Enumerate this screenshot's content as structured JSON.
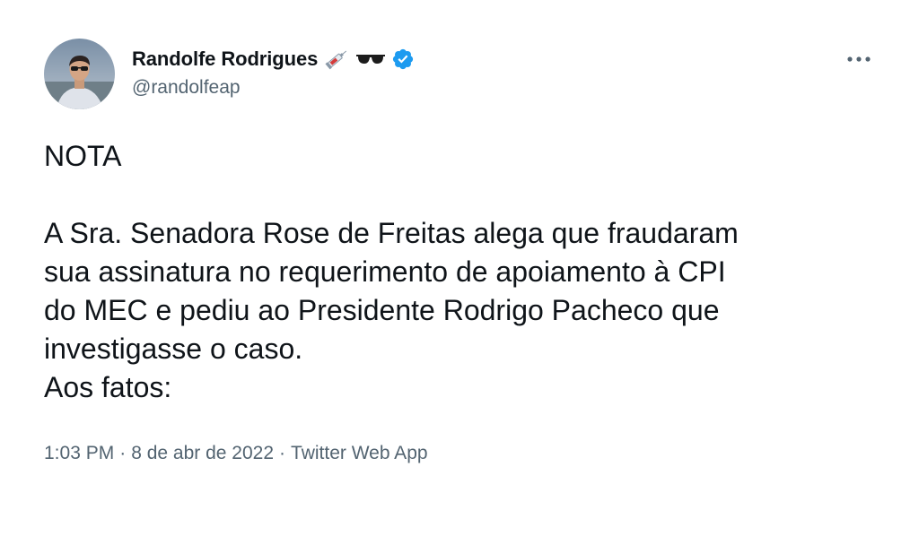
{
  "tweet": {
    "author": {
      "name": "Randolfe Rodrigues",
      "handle": "@randolfeap",
      "emojis": [
        "syringe-icon",
        "sunglasses-icon"
      ],
      "verified": true
    },
    "more_label": "•••",
    "text": "NOTA\n\nA Sra. Senadora Rose de Freitas alega que fraudaram\nsua assinatura no requerimento de apoiamento à CPI\ndo MEC e pediu ao Presidente Rodrigo Pacheco que\ninvestigasse o caso.\nAos fatos:",
    "time": "1:03 PM",
    "date": "8 de abr de 2022",
    "source": "Twitter Web App",
    "separator": "·"
  },
  "colors": {
    "text": "#0f1419",
    "secondary": "#536471",
    "verified": "#1d9bf0"
  }
}
